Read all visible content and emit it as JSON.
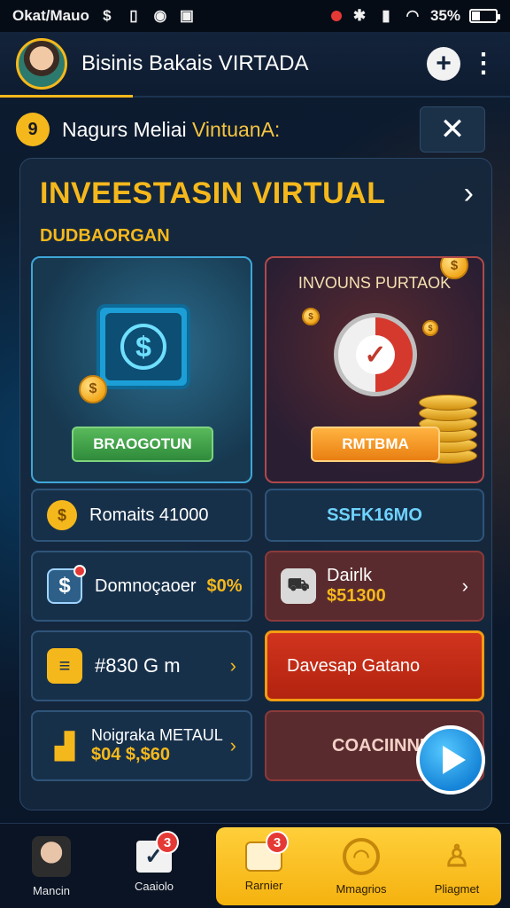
{
  "status_bar": {
    "left_text": "Okat/Mauo",
    "battery": "35%",
    "battery_level": 0.35
  },
  "header": {
    "title": "Bisinis Bakais VIRTADA"
  },
  "notice": {
    "number": "9",
    "text_plain": "Nagurs Meliai",
    "text_highlight": "VintuanA:"
  },
  "panel": {
    "title": "INVEESTASIN VIRTUAL",
    "subtitle": "DUDBAORGAN",
    "card_left": {
      "button_label": "BRAOGOTUN"
    },
    "card_right": {
      "heading": "INVOUNS PURTAOK",
      "button_label": "RMTBMA"
    }
  },
  "rows": {
    "r1_left": {
      "text": "Romaits 41000"
    },
    "r1_right": {
      "text": "SSFK16MO"
    },
    "r2_left": {
      "text": "Domnoçaoer",
      "value": "$0%"
    },
    "r2_right": {
      "text": "Dairlk",
      "value": "$51300"
    },
    "r3_left": {
      "text": "#830 G m"
    },
    "r3_right": {
      "text": "Davesap Gatano"
    },
    "r4_left": {
      "text": "Noigraka METAUL",
      "value": "$04 $,$60"
    },
    "r4_right": {
      "text": "COACIINNE"
    }
  },
  "bottom_nav": {
    "items": [
      {
        "label": "Mancin"
      },
      {
        "label": "Caaiolo",
        "badge": "3"
      },
      {
        "label": "Rarnier",
        "badge": "3"
      },
      {
        "label": "Mmagrios"
      },
      {
        "label": "Pliagmet"
      }
    ]
  },
  "colors": {
    "accent": "#f5b81c",
    "background": "#0b1a2e",
    "panel": "#16283e"
  }
}
